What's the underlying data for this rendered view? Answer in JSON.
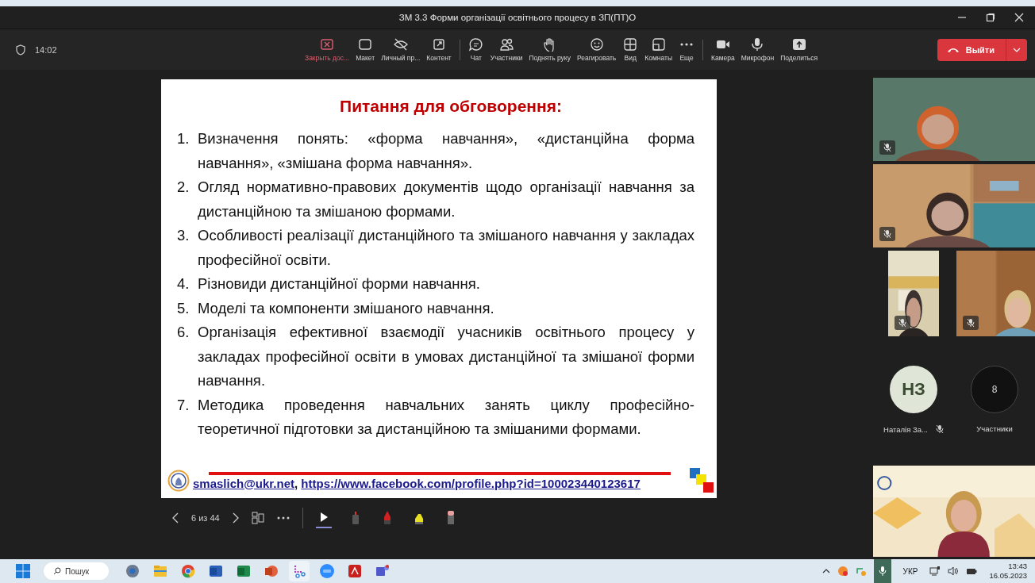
{
  "window": {
    "title": "ЗМ 3.3 Форми організації освітнього процесу в ЗП(ПТ)О"
  },
  "meeting": {
    "timer": "14:02"
  },
  "toolbar": [
    {
      "kind": "stop-share",
      "label": "Закрыть дос..."
    },
    {
      "kind": "layout",
      "label": "Макет"
    },
    {
      "kind": "private",
      "label": "Личный пр..."
    },
    {
      "kind": "content",
      "label": "Контент"
    },
    {
      "kind": "divider"
    },
    {
      "kind": "chat",
      "label": "Чат"
    },
    {
      "kind": "people",
      "label": "Участники"
    },
    {
      "kind": "hand",
      "label": "Поднять руку"
    },
    {
      "kind": "react",
      "label": "Реагировать"
    },
    {
      "kind": "view",
      "label": "Вид"
    },
    {
      "kind": "rooms",
      "label": "Комнаты"
    },
    {
      "kind": "more",
      "label": "Еще"
    },
    {
      "kind": "divider"
    },
    {
      "kind": "camera",
      "label": "Камера"
    },
    {
      "kind": "mic",
      "label": "Микрофон"
    },
    {
      "kind": "share",
      "label": "Поделиться"
    }
  ],
  "leave_button": {
    "label": "Выйти"
  },
  "slide": {
    "title": "Питання для обговорення:",
    "items": [
      {
        "number": "1.",
        "text": "Визначення понять: «форма навчання», «дистанційна форма навчання», «змішана форма навчання»."
      },
      {
        "number": "2.",
        "text": "Огляд нормативно-правових документів щодо організації навчання за дистанційною та змішаною формами."
      },
      {
        "number": "3.",
        "text": "Особливості реалізації дистанційного та змішаного навчання у закладах професійної освіти."
      },
      {
        "number": "4.",
        "text": "Різновиди дистанційної форми навчання."
      },
      {
        "number": "5.",
        "text": "Моделі та компоненти змішаного навчання."
      },
      {
        "number": "6.",
        "text": "Організація ефективної взаємодії учасників освітнього процесу у закладах професійної освіти в умовах дистанційної та змішаної форми навчання."
      },
      {
        "number": "7.",
        "text": "Методика проведення навчальних занять циклу професійно-теоретичної підготовки за дистанційною та змішаними формами."
      }
    ],
    "email": "smaslich@ukr.net",
    "separator": ",",
    "profile_link": "https://www.facebook.com/profile.php?id=100023440123617"
  },
  "slide_controls": {
    "page": "6 из 44",
    "tools": [
      {
        "kind": "pointer",
        "selected": true
      },
      {
        "kind": "pen",
        "selected": false
      },
      {
        "kind": "marker",
        "selected": false
      },
      {
        "kind": "highlighter",
        "selected": false
      },
      {
        "kind": "eraser",
        "selected": false
      }
    ]
  },
  "video_tiles": [
    {
      "kind": "picture",
      "muted": true
    },
    {
      "kind": "picture",
      "muted": true
    },
    {
      "kind": "picture",
      "muted": true
    },
    {
      "kind": "picture",
      "muted": true
    }
  ],
  "participant": {
    "initials": "НЗ",
    "name": "Наталія За...",
    "muted": true
  },
  "participants_count": {
    "count": "8",
    "label": "Участники"
  },
  "presenter_video": {
    "kind": "picture"
  },
  "taskbar": {
    "search": "Пошук",
    "apps": [
      {
        "kind": "settings"
      },
      {
        "kind": "files"
      },
      {
        "kind": "chrome"
      },
      {
        "kind": "word"
      },
      {
        "kind": "excel"
      },
      {
        "kind": "powerpoint"
      },
      {
        "kind": "snip"
      },
      {
        "kind": "zoom"
      },
      {
        "kind": "pdf"
      },
      {
        "kind": "teams"
      }
    ],
    "language": "УКР",
    "time": "13:43",
    "date": "16.05.2023"
  }
}
